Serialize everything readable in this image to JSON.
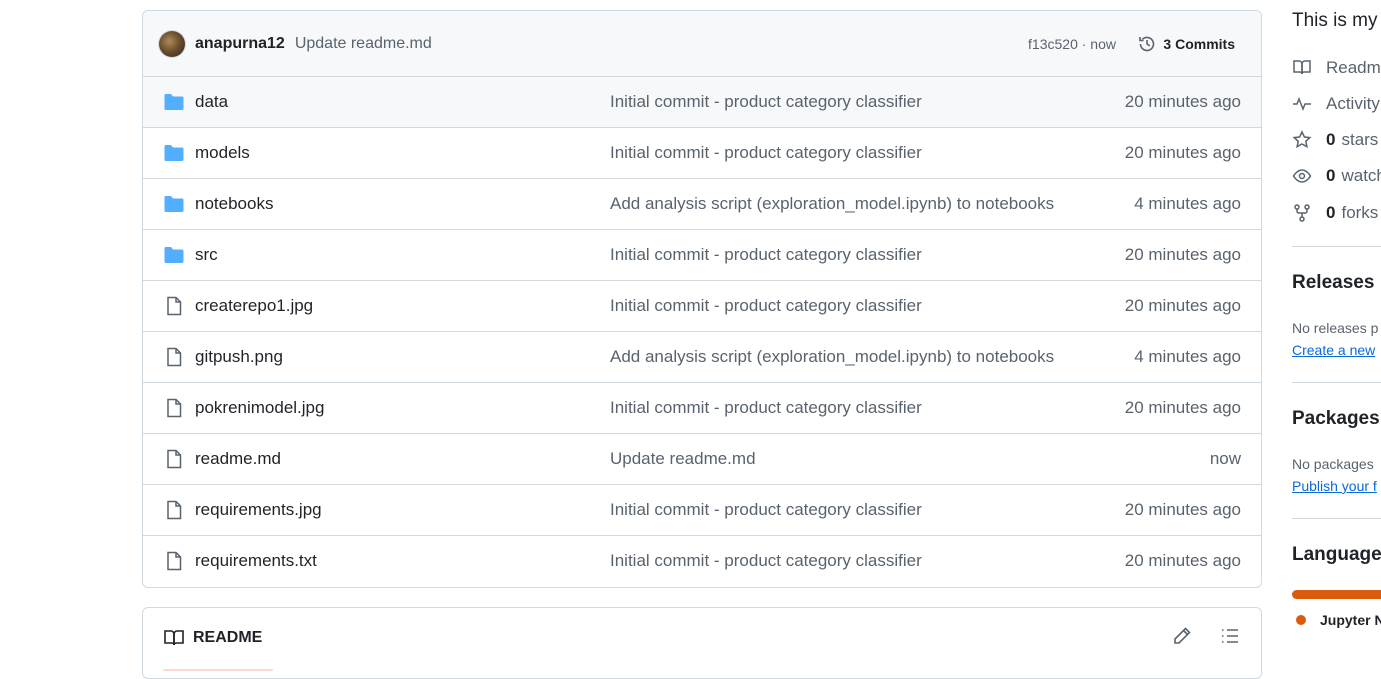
{
  "latest_commit": {
    "author": "anapurna12",
    "message": "Update readme.md",
    "meta": "f13c520 · now",
    "commits_label": "3 Commits"
  },
  "files": [
    {
      "type": "folder",
      "name": "data",
      "commit": "Initial commit - product category classifier",
      "time": "20 minutes ago"
    },
    {
      "type": "folder",
      "name": "models",
      "commit": "Initial commit - product category classifier",
      "time": "20 minutes ago"
    },
    {
      "type": "folder",
      "name": "notebooks",
      "commit": "Add analysis script (exploration_model.ipynb) to notebooks",
      "time": "4 minutes ago"
    },
    {
      "type": "folder",
      "name": "src",
      "commit": "Initial commit - product category classifier",
      "time": "20 minutes ago"
    },
    {
      "type": "file",
      "name": "createrepo1.jpg",
      "commit": "Initial commit - product category classifier",
      "time": "20 minutes ago"
    },
    {
      "type": "file",
      "name": "gitpush.png",
      "commit": "Add analysis script (exploration_model.ipynb) to notebooks",
      "time": "4 minutes ago"
    },
    {
      "type": "file",
      "name": "pokrenimodel.jpg",
      "commit": "Initial commit - product category classifier",
      "time": "20 minutes ago"
    },
    {
      "type": "file",
      "name": "readme.md",
      "commit": "Update readme.md",
      "time": "now"
    },
    {
      "type": "file",
      "name": "requirements.jpg",
      "commit": "Initial commit - product category classifier",
      "time": "20 minutes ago"
    },
    {
      "type": "file",
      "name": "requirements.txt",
      "commit": "Initial commit - product category classifier",
      "time": "20 minutes ago"
    }
  ],
  "readme": {
    "title": "README"
  },
  "sidebar": {
    "about": "This is my",
    "readme_link": "Readm",
    "activity_link": "Activity",
    "stars_count": "0",
    "stars_label": "stars",
    "watch_count": "0",
    "watch_label": "watch",
    "forks_count": "0",
    "forks_label": "forks",
    "releases_heading": "Releases",
    "releases_text": "No releases p",
    "releases_link": "Create a new",
    "packages_heading": "Packages",
    "packages_text": "No packages",
    "packages_link": "Publish your f",
    "languages_heading": "Language",
    "language_name": "Jupyter N"
  },
  "colors": {
    "folder": "#54aeff",
    "language": "#da5b0b",
    "link": "#0969da"
  }
}
